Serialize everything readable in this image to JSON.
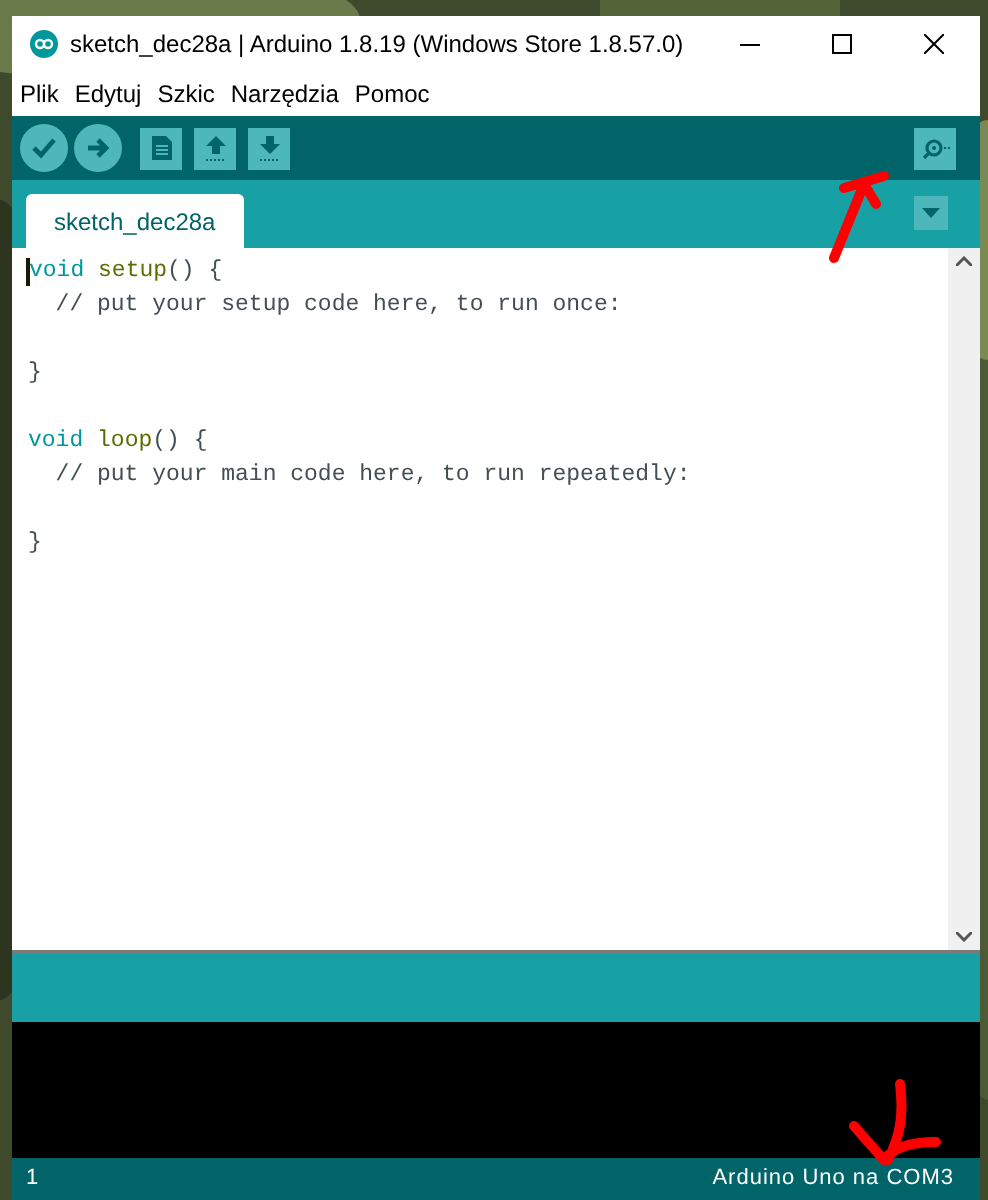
{
  "window": {
    "title": "sketch_dec28a | Arduino 1.8.19 (Windows Store 1.8.57.0)"
  },
  "menu": [
    "Plik",
    "Edytuj",
    "Szkic",
    "Narzędzia",
    "Pomoc"
  ],
  "toolbar": [
    {
      "kind": "verify"
    },
    {
      "kind": "upload"
    },
    {
      "kind": "new"
    },
    {
      "kind": "open"
    },
    {
      "kind": "save"
    }
  ],
  "tabs": [
    {
      "label": "sketch_dec28a",
      "selected": true
    }
  ],
  "code": [
    {
      "tokens": [
        {
          "kind": "keyword",
          "text": "void "
        },
        {
          "kind": "function",
          "text": "setup"
        },
        {
          "kind": "plain",
          "text": "() {"
        }
      ]
    },
    {
      "tokens": [
        {
          "kind": "comment",
          "text": "  // put your setup code here, to run once:"
        }
      ]
    },
    {
      "blank_before": true,
      "tokens": [
        {
          "kind": "plain",
          "text": "}"
        }
      ]
    },
    {
      "blank_before": true,
      "tokens": [
        {
          "kind": "keyword",
          "text": "void "
        },
        {
          "kind": "function",
          "text": "loop"
        },
        {
          "kind": "plain",
          "text": "() {"
        }
      ]
    },
    {
      "tokens": [
        {
          "kind": "comment",
          "text": "  // put your main code here, to run repeatedly:"
        }
      ]
    },
    {
      "blank_before": true,
      "tokens": [
        {
          "kind": "plain",
          "text": "}"
        }
      ]
    }
  ],
  "status_bar": {
    "line": "1",
    "board": "Arduino Uno na COM3"
  }
}
